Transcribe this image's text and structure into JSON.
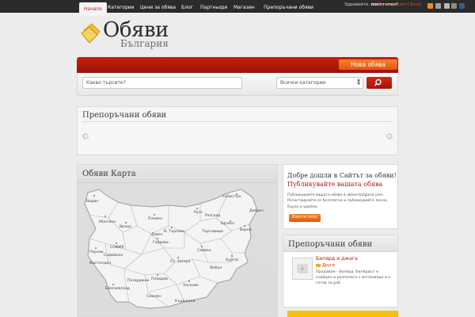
{
  "topbar": {
    "greeting_prefix": "Здравейте, ",
    "greeting_name": "посетител!",
    "register": "Регистрация",
    "sep": "|",
    "login": "Вход"
  },
  "logo": {
    "title": "Обяви",
    "subtitle": "България"
  },
  "nav": {
    "items": [
      "Начало",
      "Категории",
      "Цени за обява",
      "Блог",
      "Партньори",
      "Магазин",
      "Препоръчани обяви"
    ],
    "new_ad": "Нова обява"
  },
  "search": {
    "placeholder": "Какво търсите?",
    "category": "Всички категории"
  },
  "featured_top": {
    "title": "Препоръчани обяви"
  },
  "map": {
    "title": "Обяви Карта",
    "cities": [
      "Видин",
      "Монтана",
      "Враца",
      "Плевен",
      "Русе",
      "Разград",
      "Силистра",
      "Добрич",
      "Шумен",
      "Търговище",
      "Варна",
      "В. Търново",
      "Ловеч",
      "Габрово",
      "Бургас",
      "Сливен",
      "Ямбол",
      "Ст. Загора",
      "Хасково",
      "Кърджали",
      "Смолян",
      "Пловдив",
      "Пазарджик",
      "Благоевград",
      "Кюстендил",
      "Перник",
      "София",
      "Софийска"
    ]
  },
  "welcome": {
    "line1": "Добре дошли в Сайтът за обяви!",
    "line2": "Публикувайте вашата обява",
    "text": "Публикувайте вашата обява в obiavi-bulgaria.com. Регистрирайте се безплатно и публикувайте лесно, бързо и удобно.",
    "button": "Влезте сега!"
  },
  "featured_side": {
    "title": "Препоръчани обяви",
    "item_title": "Билярд и джага",
    "item_category": "Други",
    "item_desc": "Продавам - билярд. Билярдът е снабден и разполага с жетониера и е готов за раб.."
  },
  "colors": {
    "accent": "#b5150a",
    "orange": "#e2580d",
    "topbar": "#2b2b2b"
  }
}
